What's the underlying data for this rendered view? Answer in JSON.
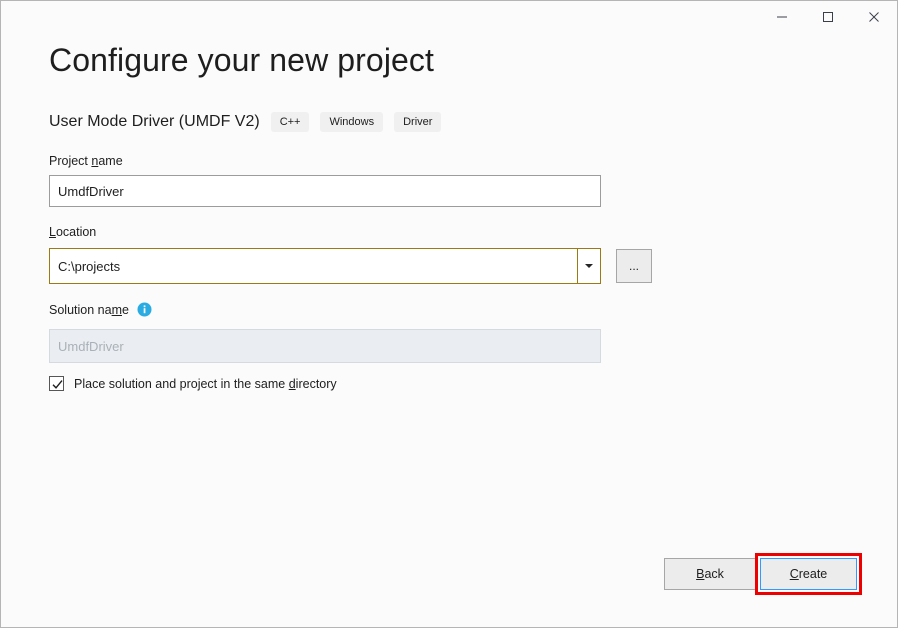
{
  "window": {
    "background_color": "#fbfbfb",
    "border_color": "#b5b5b5",
    "caption_buttons": [
      {
        "name": "minimize",
        "icon": "minimize-icon",
        "tooltip": "Minimize"
      },
      {
        "name": "maximize",
        "icon": "maximize-icon",
        "tooltip": "Maximize"
      },
      {
        "name": "close",
        "icon": "close-icon",
        "tooltip": "Close"
      }
    ]
  },
  "header": {
    "title": "Configure your new project",
    "template_name": "User Mode Driver (UMDF V2)",
    "tags": [
      "C++",
      "Windows",
      "Driver"
    ]
  },
  "form": {
    "project_name": {
      "label_before": "Project ",
      "label_accesskey": "n",
      "label_after": "ame",
      "value": "UmdfDriver",
      "placeholder": ""
    },
    "location": {
      "label_accesskey": "L",
      "label_after": "ocation",
      "value": "C:\\projects",
      "placeholder": "",
      "dropdown_icon": "chevron-down-icon",
      "focused": true,
      "focus_border_color": "#9b7a16"
    },
    "browse_button": {
      "label": "...",
      "tooltip": "Browse"
    },
    "solution_name": {
      "label_before": "Solution na",
      "label_accesskey": "m",
      "label_after": "e",
      "value": "",
      "placeholder": "UmdfDriver",
      "disabled": true,
      "info_icon": "info-icon",
      "info_icon_color": "#2aabe2"
    },
    "same_directory": {
      "checked": true,
      "label_before": "Place solution and project in the same ",
      "label_accesskey": "d",
      "label_after": "irectory"
    }
  },
  "footer": {
    "back_button": {
      "label_accesskey": "B",
      "label_after": "ack"
    },
    "create_button": {
      "label_accesskey": "C",
      "label_after": "reate",
      "focused": true,
      "focus_border_color": "#3399ff",
      "highlight_color": "#ec0000"
    }
  }
}
